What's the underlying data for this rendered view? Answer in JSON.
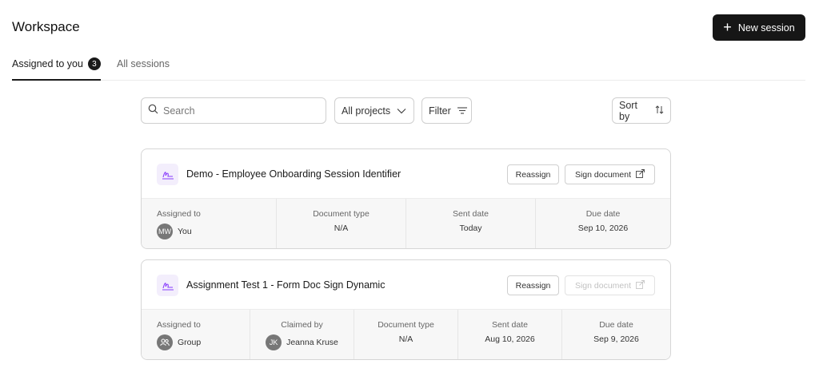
{
  "header": {
    "title": "Workspace",
    "new_session_label": "New session"
  },
  "tabs": [
    {
      "label": "Assigned to you",
      "count": "3"
    },
    {
      "label": "All sessions"
    }
  ],
  "toolbar": {
    "search_placeholder": "Search",
    "projects_label": "All projects",
    "filter_label": "Filter",
    "sort_label": "Sort by"
  },
  "cards": [
    {
      "title": "Demo - Employee Onboarding Session Identifier",
      "reassign_label": "Reassign",
      "sign_label": "Sign document",
      "sign_enabled": true,
      "meta": [
        {
          "label": "Assigned to",
          "value": "You",
          "avatar": "MW"
        },
        {
          "label": "Document type",
          "value": "N/A"
        },
        {
          "label": "Sent date",
          "value": "Today"
        },
        {
          "label": "Due date",
          "value": "Sep 10, 2026"
        }
      ]
    },
    {
      "title": "Assignment Test 1 - Form Doc Sign Dynamic",
      "reassign_label": "Reassign",
      "sign_label": "Sign document",
      "sign_enabled": false,
      "meta": [
        {
          "label": "Assigned to",
          "value": "Group",
          "avatar_icon": "group-icon"
        },
        {
          "label": "Claimed by",
          "value": "Jeanna Kruse",
          "avatar": "JK"
        },
        {
          "label": "Document type",
          "value": "N/A"
        },
        {
          "label": "Sent date",
          "value": "Aug 10, 2026"
        },
        {
          "label": "Due date",
          "value": "Sep 9, 2026"
        }
      ]
    }
  ],
  "colors": {
    "primary_button": "#161616",
    "doc_icon_bg": "#f3eefc",
    "doc_icon_fg": "#8a3ffc"
  }
}
